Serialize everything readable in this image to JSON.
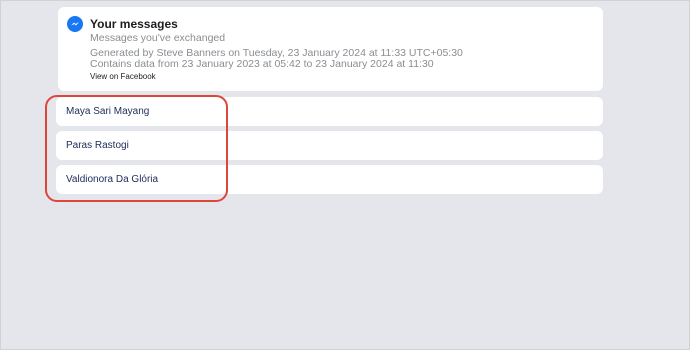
{
  "header": {
    "icon": "messenger-icon",
    "title": "Your messages",
    "subtitle": "Messages you've exchanged",
    "generated_line": "Generated by Steve Banners on Tuesday, 23 January 2024 at 11:33 UTC+05:30",
    "range_line": "Contains data from 23 January 2023 at 05:42 to 23 January 2024 at 11:30",
    "view_link": "View on Facebook"
  },
  "threads": [
    {
      "name": "Maya Sari Mayang"
    },
    {
      "name": "Paras Rastogi"
    },
    {
      "name": "Valdionora Da Glória"
    }
  ],
  "colors": {
    "background": "#e4e6eb",
    "card": "#ffffff",
    "accent": "#1877f2",
    "highlight": "#e0453a"
  }
}
